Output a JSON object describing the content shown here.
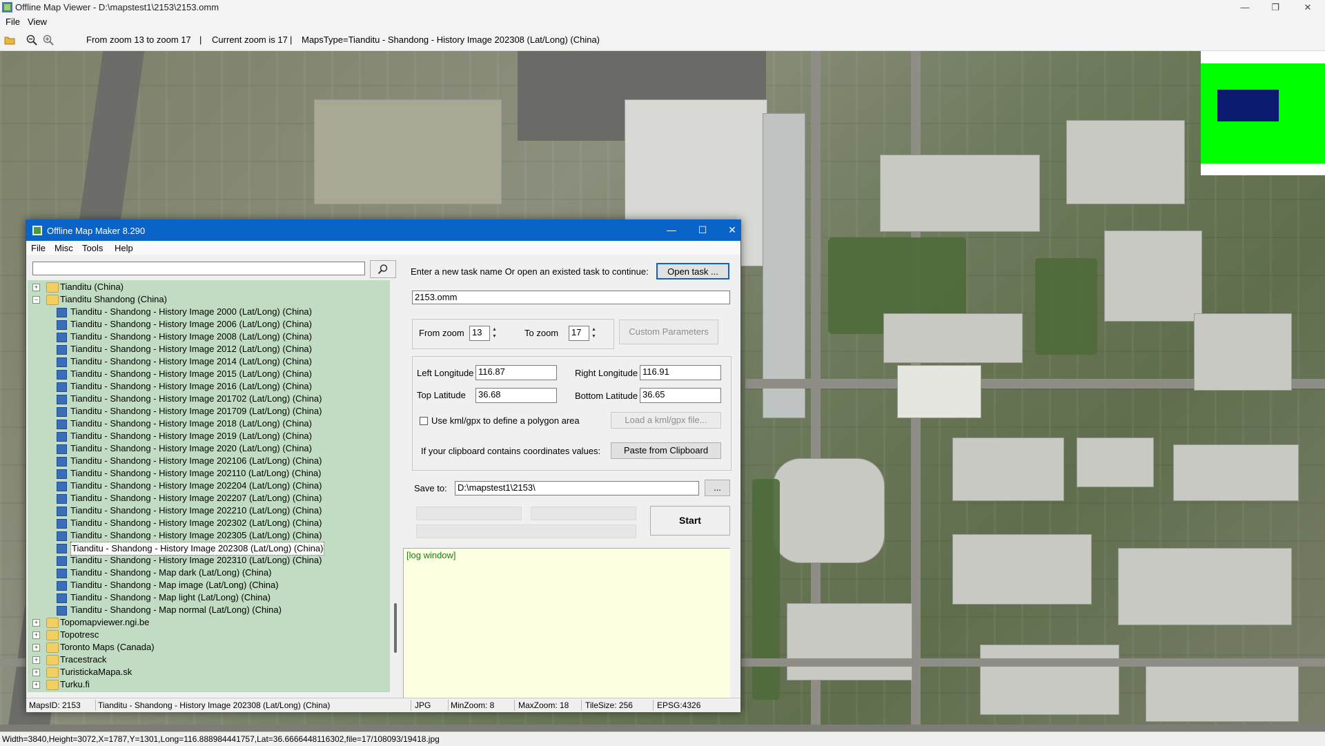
{
  "app": {
    "title": "Offline Map Viewer - D:\\mapstest1\\2153\\2153.omm",
    "menu": [
      "File",
      "View"
    ],
    "toolbar": {
      "zoom_range": "From zoom 13 to zoom 17",
      "sep1": "|",
      "current_zoom": "Current zoom is 17",
      "sep2": "|",
      "maps_type": "MapsType=Tianditu - Shandong - History Image 202308 (Lat/Long) (China)"
    },
    "status": "Width=3840,Height=3072,X=1787,Y=1301,Long=116.888984441757,Lat=36.6666448116302,file=17/108093/19418.jpg"
  },
  "colors": {
    "overview_bg": "#00ff00",
    "overview_rect": "#0a1a6e",
    "tree_bg": "#c1dcc2",
    "titlebar": "#0a64c8"
  },
  "dialog": {
    "title": "Offline Map Maker 8.290",
    "menu": [
      "File",
      "Misc",
      "Tools",
      "Help"
    ],
    "search": {
      "value": "",
      "icon": "search-icon"
    },
    "tree": [
      {
        "type": "folder",
        "state": "collapsed",
        "label": "Tianditu (China)"
      },
      {
        "type": "folder",
        "state": "expanded",
        "label": "Tianditu Shandong (China)"
      },
      {
        "type": "map",
        "label": "Tianditu - Shandong - History Image 2000 (Lat/Long) (China)"
      },
      {
        "type": "map",
        "label": "Tianditu - Shandong - History Image 2006 (Lat/Long) (China)"
      },
      {
        "type": "map",
        "label": "Tianditu - Shandong - History Image 2008 (Lat/Long) (China)"
      },
      {
        "type": "map",
        "label": "Tianditu - Shandong - History Image 2012 (Lat/Long) (China)"
      },
      {
        "type": "map",
        "label": "Tianditu - Shandong - History Image 2014 (Lat/Long) (China)"
      },
      {
        "type": "map",
        "label": "Tianditu - Shandong - History Image 2015 (Lat/Long) (China)"
      },
      {
        "type": "map",
        "label": "Tianditu - Shandong - History Image 2016 (Lat/Long) (China)"
      },
      {
        "type": "map",
        "label": "Tianditu - Shandong - History Image 201702 (Lat/Long) (China)"
      },
      {
        "type": "map",
        "label": "Tianditu - Shandong - History Image 201709 (Lat/Long) (China)"
      },
      {
        "type": "map",
        "label": "Tianditu - Shandong - History Image 2018 (Lat/Long) (China)"
      },
      {
        "type": "map",
        "label": "Tianditu - Shandong - History Image 2019 (Lat/Long) (China)"
      },
      {
        "type": "map",
        "label": "Tianditu - Shandong - History Image 2020 (Lat/Long) (China)"
      },
      {
        "type": "map",
        "label": "Tianditu - Shandong - History Image 202106 (Lat/Long) (China)"
      },
      {
        "type": "map",
        "label": "Tianditu - Shandong - History Image 202110 (Lat/Long) (China)"
      },
      {
        "type": "map",
        "label": "Tianditu - Shandong - History Image 202204 (Lat/Long) (China)"
      },
      {
        "type": "map",
        "label": "Tianditu - Shandong - History Image 202207 (Lat/Long) (China)"
      },
      {
        "type": "map",
        "label": "Tianditu - Shandong - History Image 202210 (Lat/Long) (China)"
      },
      {
        "type": "map",
        "label": "Tianditu - Shandong - History Image 202302 (Lat/Long) (China)"
      },
      {
        "type": "map",
        "label": "Tianditu - Shandong - History Image 202305 (Lat/Long) (China)"
      },
      {
        "type": "map",
        "label": "Tianditu - Shandong - History Image 202308 (Lat/Long) (China)",
        "selected": true
      },
      {
        "type": "map",
        "label": "Tianditu - Shandong - History Image 202310 (Lat/Long) (China)"
      },
      {
        "type": "map",
        "label": "Tianditu - Shandong - Map dark (Lat/Long) (China)"
      },
      {
        "type": "map",
        "label": "Tianditu - Shandong - Map image (Lat/Long) (China)"
      },
      {
        "type": "map",
        "label": "Tianditu - Shandong - Map light (Lat/Long) (China)"
      },
      {
        "type": "map",
        "label": "Tianditu - Shandong - Map normal (Lat/Long) (China)"
      },
      {
        "type": "folder",
        "state": "collapsed",
        "label": "Topomapviewer.ngi.be"
      },
      {
        "type": "folder",
        "state": "collapsed",
        "label": "Topotresc"
      },
      {
        "type": "folder",
        "state": "collapsed",
        "label": "Toronto Maps (Canada)"
      },
      {
        "type": "folder",
        "state": "collapsed",
        "label": "Tracestrack"
      },
      {
        "type": "folder",
        "state": "collapsed",
        "label": "TuristickaMapa.sk"
      },
      {
        "type": "folder",
        "state": "collapsed",
        "label": "Turku.fi"
      }
    ],
    "task": {
      "prompt": "Enter a new task name Or open an existed task to continue:",
      "open_btn": "Open task ...",
      "name": "2153.omm"
    },
    "zoom": {
      "from_label": "From zoom",
      "from_value": "13",
      "to_label": "To zoom",
      "to_value": "17",
      "custom_btn": "Custom Parameters"
    },
    "coords": {
      "left_label": "Left Longitude",
      "left": "116.87",
      "right_label": "Right Longitude",
      "right": "116.91",
      "top_label": "Top Latitude",
      "top": "36.68",
      "bottom_label": "Bottom Latitude",
      "bottom": "36.65",
      "kml_label": "Use kml/gpx to define a polygon area",
      "kml_checked": false,
      "kml_btn": "Load a kml/gpx file...",
      "clip_label": "If your clipboard contains coordinates values:",
      "clip_btn": "Paste from Clipboard"
    },
    "save": {
      "label": "Save to:",
      "path": "D:\\mapstest1\\2153\\",
      "browse": "..."
    },
    "start_btn": "Start",
    "log": "[log window]",
    "status": {
      "maps_id": "MapsID: 2153",
      "maps_name": "Tianditu - Shandong - History Image 202308 (Lat/Long) (China)",
      "format": "JPG",
      "min_zoom": "MinZoom: 8",
      "max_zoom": "MaxZoom: 18",
      "tile_size": "TileSize: 256",
      "epsg": "EPSG:4326"
    }
  }
}
